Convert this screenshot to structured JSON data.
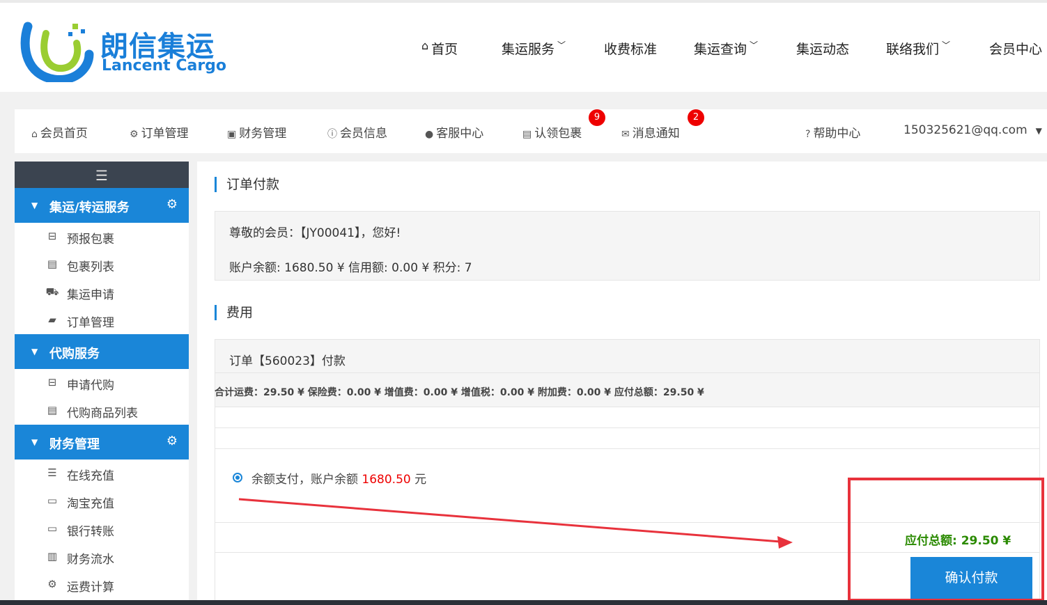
{
  "brand": {
    "name_cn": "朗信集运",
    "name_en": "Lancent Cargo"
  },
  "main_nav": [
    {
      "label": "首页",
      "icon": "home-icon"
    },
    {
      "label": "集运服务",
      "dropdown": true
    },
    {
      "label": "收费标准"
    },
    {
      "label": "集运查询",
      "dropdown": true
    },
    {
      "label": "集运动态"
    },
    {
      "label": "联络我们",
      "dropdown": true
    },
    {
      "label": "会员中心"
    }
  ],
  "sub_nav": {
    "items": [
      {
        "label": "会员首页",
        "icon": "home-icon"
      },
      {
        "label": "订单管理",
        "icon": "gear-icon"
      },
      {
        "label": "财务管理",
        "icon": "money-icon"
      },
      {
        "label": "会员信息",
        "icon": "info-icon"
      },
      {
        "label": "客服中心",
        "icon": "user-icon"
      },
      {
        "label": "认领包裹",
        "icon": "archive-icon",
        "badge": "9"
      },
      {
        "label": "消息通知",
        "icon": "envelope-icon",
        "badge": "2"
      }
    ],
    "help": "帮助中心",
    "account": "150325621@qq.com"
  },
  "sidebar": {
    "groups": [
      {
        "label": "集运/转运服务",
        "gear": true,
        "items": [
          "预报包裹",
          "包裹列表",
          "集运申请",
          "订单管理"
        ]
      },
      {
        "label": "代购服务",
        "gear": false,
        "items": [
          "申请代购",
          "代购商品列表"
        ]
      },
      {
        "label": "财务管理",
        "gear": true,
        "items": [
          "在线充值",
          "淘宝充值",
          "银行转账",
          "财务流水",
          "运费计算"
        ]
      }
    ]
  },
  "payment": {
    "section_title": "订单付款",
    "greeting": "尊敬的会员：【JY00041】，您好!",
    "balance_line": "账户余额:  1680.50 ¥    信用额:  0.00 ¥    积分:  7",
    "fee_title": "费用",
    "order_title": "订单【560023】付款",
    "fee_summary": "合计运费：29.50 ¥     保险费：0.00 ¥     增值费：0.00 ¥     增值税：0.00 ¥     附加费：0.00 ¥     应付总额：29.50 ¥",
    "method_prefix": "余额支付，账户余额 ",
    "method_amount": "1680.50",
    "method_suffix": " 元",
    "total_label": "应付总额:  29.50 ¥",
    "confirm_button": "确认付款"
  },
  "colors": {
    "accent": "#1a86d8",
    "annotation": "#e8323c",
    "total": "#2a8a00"
  }
}
